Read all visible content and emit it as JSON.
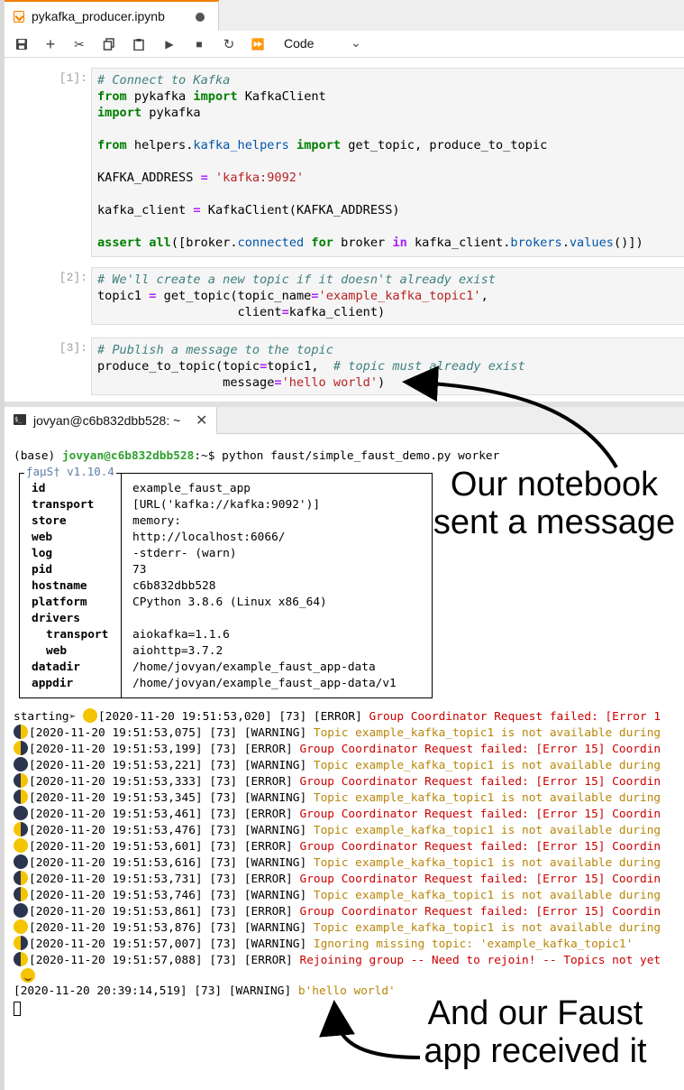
{
  "notebook": {
    "tab_title": "pykafka_producer.ipynb",
    "toolbar": {
      "cell_type": "Code"
    },
    "cells": [
      {
        "prompt": "[1]:",
        "lines": [
          [
            {
              "t": "# Connect to Kafka",
              "c": "cm"
            }
          ],
          [
            {
              "t": "from",
              "c": "kw"
            },
            {
              "t": " pykafka ",
              "c": "ex"
            },
            {
              "t": "import",
              "c": "kw"
            },
            {
              "t": " KafkaClient",
              "c": "ex"
            }
          ],
          [
            {
              "t": "import",
              "c": "kw"
            },
            {
              "t": " pykafka",
              "c": "ex"
            }
          ],
          [
            {
              "t": "",
              "c": "ex"
            }
          ],
          [
            {
              "t": "from",
              "c": "kw"
            },
            {
              "t": " helpers.",
              "c": "ex"
            },
            {
              "t": "kafka_helpers",
              "c": "at"
            },
            {
              "t": " ",
              "c": "ex"
            },
            {
              "t": "import",
              "c": "kw"
            },
            {
              "t": " get_topic, produce_to_topic",
              "c": "ex"
            }
          ],
          [
            {
              "t": "",
              "c": "ex"
            }
          ],
          [
            {
              "t": "KAFKA_ADDRESS ",
              "c": "ex"
            },
            {
              "t": "=",
              "c": "op"
            },
            {
              "t": " ",
              "c": "ex"
            },
            {
              "t": "'kafka:9092'",
              "c": "st"
            }
          ],
          [
            {
              "t": "",
              "c": "ex"
            }
          ],
          [
            {
              "t": "kafka_client ",
              "c": "ex"
            },
            {
              "t": "=",
              "c": "op"
            },
            {
              "t": " KafkaClient(KAFKA_ADDRESS)",
              "c": "ex"
            }
          ],
          [
            {
              "t": "",
              "c": "ex"
            }
          ],
          [
            {
              "t": "assert",
              "c": "kw"
            },
            {
              "t": " ",
              "c": "ex"
            },
            {
              "t": "all",
              "c": "kw"
            },
            {
              "t": "([broker.",
              "c": "ex"
            },
            {
              "t": "connected",
              "c": "at"
            },
            {
              "t": " ",
              "c": "ex"
            },
            {
              "t": "for",
              "c": "kw"
            },
            {
              "t": " broker ",
              "c": "ex"
            },
            {
              "t": "in",
              "c": "op"
            },
            {
              "t": " kafka_client.",
              "c": "ex"
            },
            {
              "t": "brokers",
              "c": "at"
            },
            {
              "t": ".",
              "c": "ex"
            },
            {
              "t": "values",
              "c": "at"
            },
            {
              "t": "()])",
              "c": "ex"
            }
          ]
        ]
      },
      {
        "prompt": "[2]:",
        "lines": [
          [
            {
              "t": "# We'll create a new topic if it doesn't already exist",
              "c": "cm"
            }
          ],
          [
            {
              "t": "topic1 ",
              "c": "ex"
            },
            {
              "t": "=",
              "c": "op"
            },
            {
              "t": " get_topic(topic_name",
              "c": "ex"
            },
            {
              "t": "=",
              "c": "op"
            },
            {
              "t": "'example_kafka_topic1'",
              "c": "st"
            },
            {
              "t": ",",
              "c": "ex"
            }
          ],
          [
            {
              "t": "                   client",
              "c": "ex"
            },
            {
              "t": "=",
              "c": "op"
            },
            {
              "t": "kafka_client)",
              "c": "ex"
            }
          ]
        ]
      },
      {
        "prompt": "[3]:",
        "lines": [
          [
            {
              "t": "# Publish a message to the topic",
              "c": "cm"
            }
          ],
          [
            {
              "t": "produce_to_topic(topic",
              "c": "ex"
            },
            {
              "t": "=",
              "c": "op"
            },
            {
              "t": "topic1,  ",
              "c": "ex"
            },
            {
              "t": "# topic must already exist",
              "c": "cm"
            }
          ],
          [
            {
              "t": "                 message",
              "c": "ex"
            },
            {
              "t": "=",
              "c": "op"
            },
            {
              "t": "'hello world'",
              "c": "st"
            },
            {
              "t": ")",
              "c": "ex"
            }
          ]
        ]
      }
    ]
  },
  "terminal": {
    "tab_title": "jovyan@c6b832dbb528: ~",
    "icon_text": "$_",
    "prompt_base": "(base) ",
    "prompt_user": "jovyan@c6b832dbb528",
    "prompt_path": ":~$ python faust/simple_faust_demo.py worker",
    "faust_label": "ƒaµS† v1.10.4",
    "faust_rows": [
      {
        "key": "id",
        "value": "example_faust_app",
        "sub": false
      },
      {
        "key": "transport",
        "value": "[URL('kafka://kafka:9092')]",
        "sub": false
      },
      {
        "key": "store",
        "value": "memory:",
        "sub": false
      },
      {
        "key": "web",
        "value": "http://localhost:6066/",
        "sub": false
      },
      {
        "key": "log",
        "value": "-stderr- (warn)",
        "sub": false
      },
      {
        "key": "pid",
        "value": "73",
        "sub": false
      },
      {
        "key": "hostname",
        "value": "c6b832dbb528",
        "sub": false
      },
      {
        "key": "platform",
        "value": "CPython 3.8.6 (Linux x86_64)",
        "sub": false
      },
      {
        "key": "drivers",
        "value": "",
        "sub": false
      },
      {
        "key": "transport",
        "value": "aiokafka=1.1.6",
        "sub": true
      },
      {
        "key": "web",
        "value": "aiohttp=3.7.2",
        "sub": true
      },
      {
        "key": "datadir",
        "value": "/home/jovyan/example_faust_app-data",
        "sub": false
      },
      {
        "key": "appdir",
        "value": "/home/jovyan/example_faust_app-data/v1",
        "sub": false
      }
    ],
    "starting_prefix": "starting➢ ",
    "log_lines": [
      {
        "moon": "full",
        "ts": "[2020-11-20 19:51:53,020] [73] [ERROR] ",
        "msg": "Group Coordinator Request failed: [Error 1",
        "lvl": "err"
      },
      {
        "moon": "half",
        "ts": "[2020-11-20 19:51:53,075] [73] [WARNING] ",
        "msg": "Topic example_kafka_topic1 is not available during",
        "lvl": "warn"
      },
      {
        "moon": "half-r",
        "ts": "[2020-11-20 19:51:53,199] [73] [ERROR] ",
        "msg": "Group Coordinator Request failed: [Error 15] Coordin",
        "lvl": "err"
      },
      {
        "moon": "new",
        "ts": "[2020-11-20 19:51:53,221] [73] [WARNING] ",
        "msg": "Topic example_kafka_topic1 is not available during",
        "lvl": "warn"
      },
      {
        "moon": "half",
        "ts": "[2020-11-20 19:51:53,333] [73] [ERROR] ",
        "msg": "Group Coordinator Request failed: [Error 15] Coordin",
        "lvl": "err"
      },
      {
        "moon": "half",
        "ts": "[2020-11-20 19:51:53,345] [73] [WARNING] ",
        "msg": "Topic example_kafka_topic1 is not available during",
        "lvl": "warn"
      },
      {
        "moon": "new",
        "ts": "[2020-11-20 19:51:53,461] [73] [ERROR] ",
        "msg": "Group Coordinator Request failed: [Error 15] Coordin",
        "lvl": "err"
      },
      {
        "moon": "half-r",
        "ts": "[2020-11-20 19:51:53,476] [73] [WARNING] ",
        "msg": "Topic example_kafka_topic1 is not available during",
        "lvl": "warn"
      },
      {
        "moon": "full",
        "ts": "[2020-11-20 19:51:53,601] [73] [ERROR] ",
        "msg": "Group Coordinator Request failed: [Error 15] Coordin",
        "lvl": "err"
      },
      {
        "moon": "new",
        "ts": "[2020-11-20 19:51:53,616] [73] [WARNING] ",
        "msg": "Topic example_kafka_topic1 is not available during",
        "lvl": "warn"
      },
      {
        "moon": "half",
        "ts": "[2020-11-20 19:51:53,731] [73] [ERROR] ",
        "msg": "Group Coordinator Request failed: [Error 15] Coordin",
        "lvl": "err"
      },
      {
        "moon": "half",
        "ts": "[2020-11-20 19:51:53,746] [73] [WARNING] ",
        "msg": "Topic example_kafka_topic1 is not available during",
        "lvl": "warn"
      },
      {
        "moon": "new",
        "ts": "[2020-11-20 19:51:53,861] [73] [ERROR] ",
        "msg": "Group Coordinator Request failed: [Error 15] Coordin",
        "lvl": "err"
      },
      {
        "moon": "full",
        "ts": "[2020-11-20 19:51:53,876] [73] [WARNING] ",
        "msg": "Topic example_kafka_topic1 is not available during",
        "lvl": "warn"
      },
      {
        "moon": "half-r",
        "ts": "[2020-11-20 19:51:57,007] [73] [WARNING] ",
        "msg": "Ignoring missing topic: 'example_kafka_topic1'",
        "lvl": "warn"
      },
      {
        "moon": "half",
        "ts": "[2020-11-20 19:51:57,088] [73] [ERROR] ",
        "msg": "Rejoining group -- Need to rejoin! -- Topics not yet",
        "lvl": "err"
      }
    ],
    "received_ts": "[2020-11-20 20:39:14,519] [73] [WARNING] ",
    "received_msg": "b'hello world'"
  },
  "annotations": {
    "top_line1": "Our notebook",
    "top_line2": "sent a message",
    "bottom_line1": "And our Faust",
    "bottom_line2": "app received it"
  }
}
